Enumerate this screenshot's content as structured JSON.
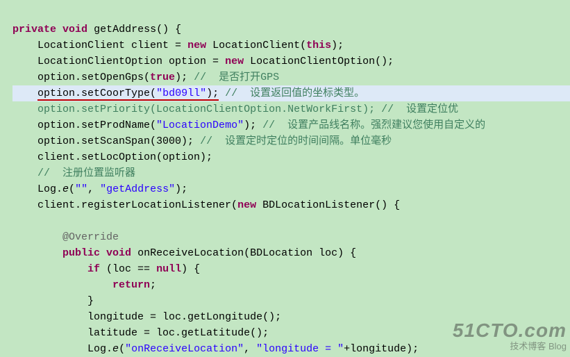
{
  "code": {
    "l1_kw1": "private",
    "l1_kw2": "void",
    "l1_name": "getAddress",
    "l1_rest": "() {",
    "l2_a": "LocationClient client = ",
    "l2_kw": "new",
    "l2_b": " LocationClient(",
    "l2_kw2": "this",
    "l2_c": ");",
    "l3_a": "LocationClientOption option = ",
    "l3_kw": "new",
    "l3_b": " LocationClientOption();",
    "l4_a": "option.setOpenGps(",
    "l4_kw": "true",
    "l4_b": ");",
    "l4_c": " // ",
    "l4_cmt": " 是否打开GPS",
    "l5_a": "option",
    "l5_b": ".setCoorType(",
    "l5_str": "\"bd09ll\"",
    "l5_c": ");",
    "l5_d": " // ",
    "l5_cmt": " 设置返回值的坐标类型。",
    "l6_a": "option.setPriority(LocationClientOption.NetWorkFirst);",
    "l6_b": " // ",
    "l6_cmt": " 设置定位优",
    "l7_a": "option.setProdName(",
    "l7_str": "\"LocationDemo\"",
    "l7_b": ");",
    "l7_c": " // ",
    "l7_cmt": " 设置产品线名称。强烈建议您使用自定义的",
    "l8_a": "option.setScanSpan(3000);",
    "l8_b": " // ",
    "l8_cmt": " 设置定时定位的时间间隔。单位毫秒",
    "l9": "client.setLocOption(option);",
    "l10_a": "// ",
    "l10_cmt": " 注册位置监听器",
    "l11_a": "Log.",
    "l11_m": "e",
    "l11_b": "(",
    "l11_s1": "\"\"",
    "l11_c": ", ",
    "l11_s2": "\"getAddress\"",
    "l11_d": ");",
    "l12_a": "client.registerLocationListener(",
    "l12_kw": "new",
    "l12_b": " BDLocationListener() {",
    "l13": "@Override",
    "l14_kw1": "public",
    "l14_kw2": "void",
    "l14_a": " onReceiveLocation(BDLocation loc) {",
    "l15_kw": "if",
    "l15_a": " (loc == ",
    "l15_kw2": "null",
    "l15_b": ") {",
    "l16_kw": "return",
    "l16_a": ";",
    "l17": "}",
    "l18": "longitude = loc.getLongitude();",
    "l19": "latitude = loc.getLatitude();",
    "l20_a": "Log.",
    "l20_m": "e",
    "l20_b": "(",
    "l20_s1": "\"onReceiveLocation\"",
    "l20_c": ", ",
    "l20_s2": "\"longitude = \"",
    "l20_d": "+longitude);"
  },
  "watermark": {
    "big": "51CTO.com",
    "small": "技术博客  Blog"
  }
}
